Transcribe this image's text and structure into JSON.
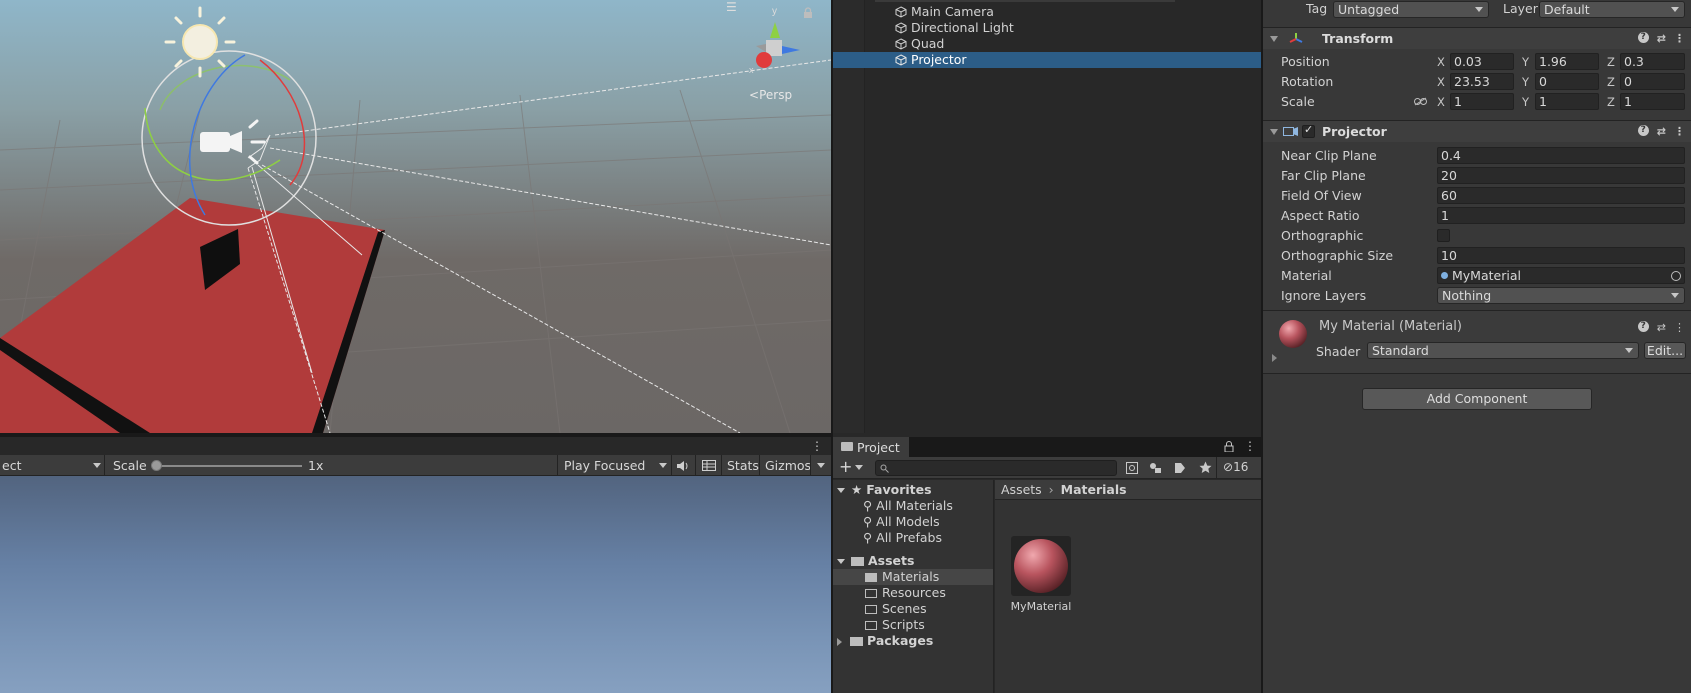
{
  "scene": {
    "persp_label": "Persp",
    "menu_glyph": "☰"
  },
  "game_toolbar": {
    "display_partial": "ect",
    "scale_label": "Scale",
    "scale_value": "1x",
    "play_mode": "Play Focused",
    "stats": "Stats",
    "gizmos": "Gizmos"
  },
  "hierarchy": {
    "items": [
      {
        "label": "Main Camera",
        "selected": false
      },
      {
        "label": "Directional Light",
        "selected": false
      },
      {
        "label": "Quad",
        "selected": false
      },
      {
        "label": "Projector",
        "selected": true
      }
    ]
  },
  "project": {
    "tab": "Project",
    "hidden_count": "16",
    "tree": {
      "favorites": "Favorites",
      "fav_items": [
        "All Materials",
        "All Models",
        "All Prefabs"
      ],
      "assets": "Assets",
      "asset_items": [
        "Materials",
        "Resources",
        "Scenes",
        "Scripts"
      ],
      "packages": "Packages"
    },
    "breadcrumb": {
      "root": "Assets",
      "current": "Materials"
    },
    "files": [
      {
        "name": "MyMaterial"
      }
    ]
  },
  "inspector": {
    "tag_label": "Tag",
    "tag_value": "Untagged",
    "layer_label": "Layer",
    "layer_value": "Default",
    "transform": {
      "title": "Transform",
      "position": {
        "label": "Position",
        "x": "0.03",
        "y": "1.96",
        "z": "0.3"
      },
      "rotation": {
        "label": "Rotation",
        "x": "23.53",
        "y": "0",
        "z": "0"
      },
      "scale": {
        "label": "Scale",
        "x": "1",
        "y": "1",
        "z": "1"
      }
    },
    "projector": {
      "title": "Projector",
      "near_clip": {
        "label": "Near Clip Plane",
        "value": "0.4"
      },
      "far_clip": {
        "label": "Far Clip Plane",
        "value": "20"
      },
      "fov": {
        "label": "Field Of View",
        "value": "60"
      },
      "aspect": {
        "label": "Aspect Ratio",
        "value": "1"
      },
      "ortho": {
        "label": "Orthographic"
      },
      "ortho_size": {
        "label": "Orthographic Size",
        "value": "10"
      },
      "material": {
        "label": "Material",
        "value": "MyMaterial"
      },
      "ignore_layers": {
        "label": "Ignore Layers",
        "value": "Nothing"
      }
    },
    "material": {
      "title": "My Material (Material)",
      "shader_label": "Shader",
      "shader_value": "Standard",
      "edit_label": "Edit..."
    },
    "add_component": "Add Component"
  },
  "colors": {
    "selection": "#2c5d87",
    "quad_red": "#a33a3a",
    "sky_top": "#52647f",
    "sky_bottom": "#86a0c0"
  }
}
